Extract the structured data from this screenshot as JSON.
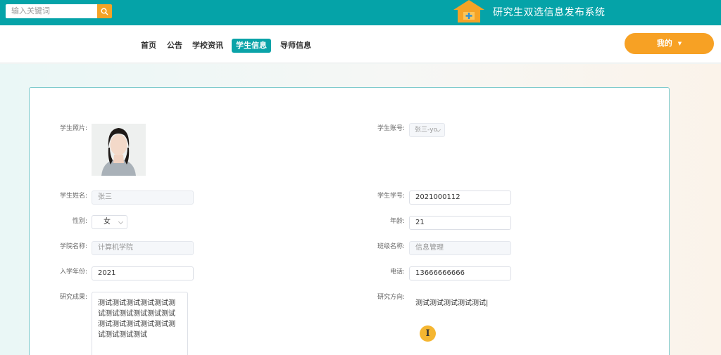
{
  "header": {
    "search_placeholder": "输入关键词",
    "system_title": "研究生双选信息发布系统"
  },
  "nav": {
    "items": [
      {
        "label": "首页"
      },
      {
        "label": "公告"
      },
      {
        "label": "学校资讯"
      },
      {
        "label": "学生信息"
      },
      {
        "label": "导师信息"
      }
    ],
    "active_index": 3,
    "me_label": "我的"
  },
  "form": {
    "photo_label": "学生照片:",
    "account_label": "学生账号:",
    "account_value": "张三-yo",
    "name_label": "学生姓名:",
    "name_value": "张三",
    "student_no_label": "学生学号:",
    "student_no_value": "2021000112",
    "gender_label": "性别:",
    "gender_value": "女",
    "age_label": "年龄:",
    "age_value": "21",
    "college_label": "学院名称:",
    "college_value": "计算机学院",
    "class_label": "班级名称:",
    "class_value": "信息管理",
    "year_label": "入学年份:",
    "year_value": "2021",
    "phone_label": "电话:",
    "phone_value": "13666666666",
    "achievement_label": "研究成果:",
    "achievement_value": "测试测试测试测试测试测试测试测试测试测试测试测试测试测试测试测试测试测试测试测试",
    "direction_label": "研究方向:",
    "direction_value": "测试测试测试测试测试|"
  },
  "colors": {
    "primary": "#05a3a8",
    "accent": "#f7a124"
  }
}
